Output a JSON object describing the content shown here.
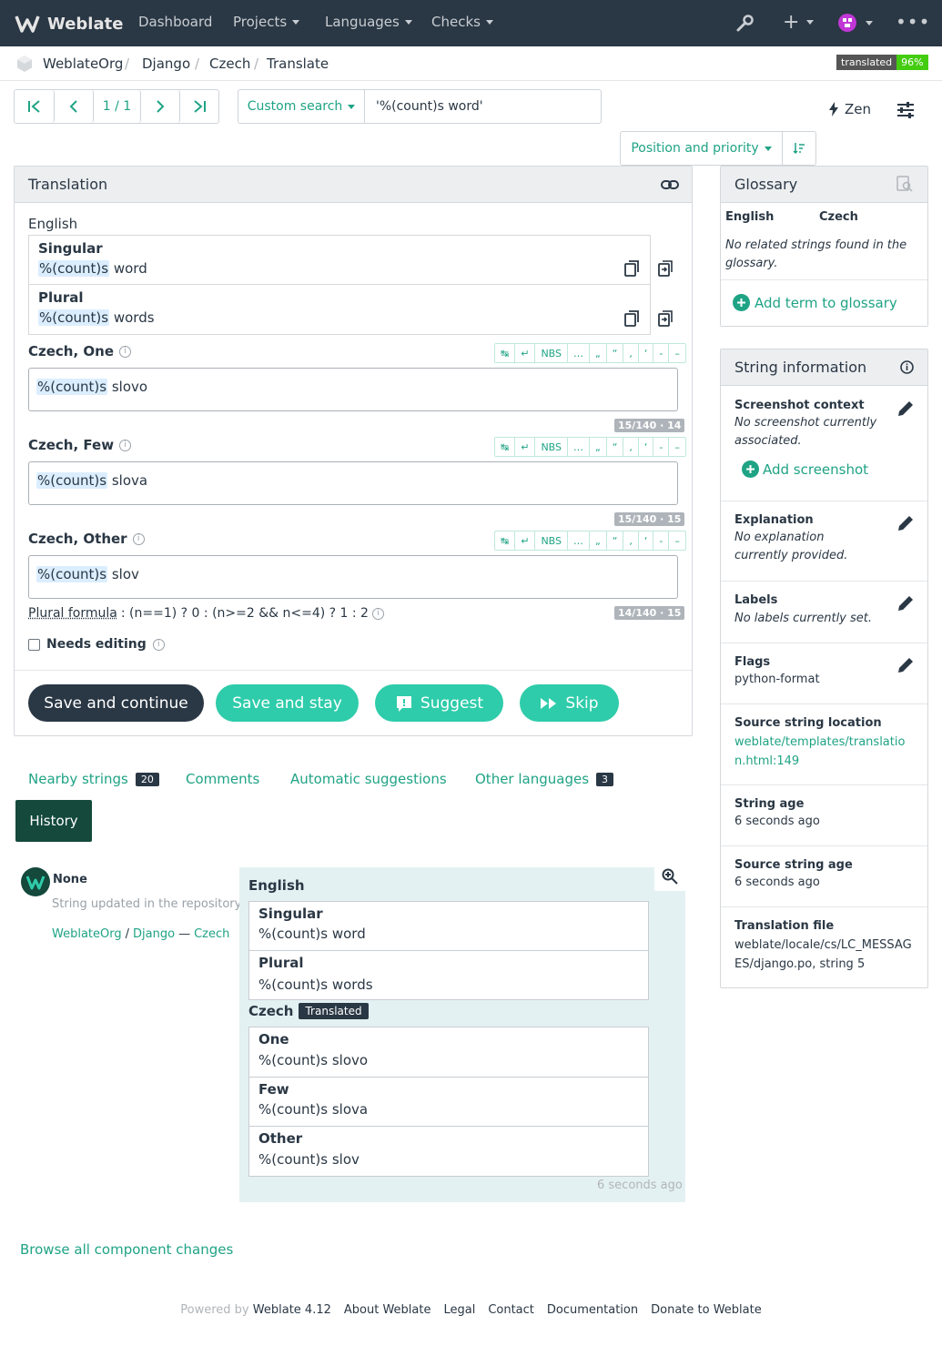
{
  "nav": {
    "brand": "Weblate",
    "items": [
      "Dashboard",
      "Projects",
      "Languages",
      "Checks"
    ]
  },
  "breadcrumb": [
    "WeblateOrg",
    "Django",
    "Czech",
    "Translate"
  ],
  "status_badge": {
    "label": "translated",
    "value": "96%"
  },
  "pager": {
    "position": "1 / 1"
  },
  "search": {
    "mode": "Custom search",
    "query": "'%(count)s word'"
  },
  "zen_label": "Zen",
  "sort_label": "Position and priority",
  "translation_panel": {
    "title": "Translation",
    "source_language": "English",
    "source": [
      {
        "label": "Singular",
        "placeholder": "%(count)s",
        "rest": " word"
      },
      {
        "label": "Plural",
        "placeholder": "%(count)s",
        "rest": " words"
      }
    ],
    "toolbar": [
      "↹",
      "↵",
      "NBS",
      "…",
      "„",
      "“",
      ",",
      "‘",
      "-",
      "–"
    ],
    "targets": [
      {
        "label": "Czech, One",
        "placeholder": "%(count)s",
        "rest": " slovo",
        "counter": "15/140 · 14"
      },
      {
        "label": "Czech, Few",
        "placeholder": "%(count)s",
        "rest": " slova",
        "counter": "15/140 · 15"
      },
      {
        "label": "Czech, Other",
        "placeholder": "%(count)s",
        "rest": " slov",
        "counter": "14/140 · 15"
      }
    ],
    "plural_formula_label": "Plural formula",
    "plural_formula": ": (n==1) ? 0 : (n>=2 && n<=4) ? 1 : 2",
    "needs_editing": "Needs editing",
    "buttons": {
      "save_continue": "Save and continue",
      "save_stay": "Save and stay",
      "suggest": "Suggest",
      "skip": "Skip"
    }
  },
  "tabs": [
    {
      "label": "Nearby strings",
      "count": "20"
    },
    {
      "label": "Comments"
    },
    {
      "label": "Automatic suggestions"
    },
    {
      "label": "Other languages",
      "count": "3"
    }
  ],
  "history_tab": "History",
  "history": {
    "user": "None",
    "action": "String updated in the repository",
    "project": "WeblateOrg",
    "slash": "/",
    "component": "Django",
    "dash": "—",
    "language": "Czech",
    "source_language": "English",
    "source": [
      {
        "label": "Singular",
        "text": "%(count)s word"
      },
      {
        "label": "Plural",
        "text": "%(count)s words"
      }
    ],
    "target_language": "Czech",
    "target_state": "Translated",
    "targets": [
      {
        "label": "One",
        "text": "%(count)s slovo"
      },
      {
        "label": "Few",
        "text": "%(count)s slova"
      },
      {
        "label": "Other",
        "text": "%(count)s slov"
      }
    ],
    "time": "6 seconds ago"
  },
  "browse_changes": "Browse all component changes",
  "glossary": {
    "title": "Glossary",
    "col_source": "English",
    "col_target": "Czech",
    "empty": "No related strings found in the glossary.",
    "add": "Add term to glossary"
  },
  "string_info": {
    "title": "String information",
    "screenshot_label": "Screenshot context",
    "screenshot_value": "No screenshot currently associated.",
    "add_screenshot": "Add screenshot",
    "explanation_label": "Explanation",
    "explanation_value": "No explanation currently provided.",
    "labels_label": "Labels",
    "labels_value": "No labels currently set.",
    "flags_label": "Flags",
    "flags_value": "python-format",
    "location_label": "Source string location",
    "location_value": "weblate/templates/translation.html:149",
    "age_label": "String age",
    "age_value": "6 seconds ago",
    "source_age_label": "Source string age",
    "source_age_value": "6 seconds ago",
    "file_label": "Translation file",
    "file_value": "weblate/locale/cs/LC_MESSAGES/django.po, string 5"
  },
  "footer": {
    "powered": "Powered by",
    "version": "Weblate 4.12",
    "links": [
      "About Weblate",
      "Legal",
      "Contact",
      "Documentation",
      "Donate to Weblate"
    ]
  },
  "colors": {
    "accent": "#1fa385",
    "navbar": "#2a3744",
    "suggest": "#2eccaa"
  }
}
